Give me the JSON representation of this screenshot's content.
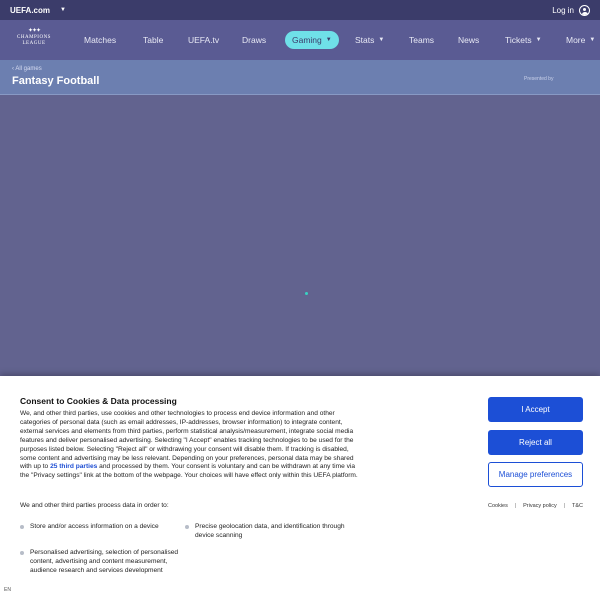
{
  "topbar": {
    "brand": "UEFA.com",
    "login": "Log in"
  },
  "logo": {
    "line1": "CHAMPIONS",
    "line2": "LEAGUE"
  },
  "nav": {
    "matches": "Matches",
    "table": "Table",
    "uefatv": "UEFA.tv",
    "draws": "Draws",
    "gaming": "Gaming",
    "stats": "Stats",
    "teams": "Teams",
    "news": "News",
    "tickets": "Tickets",
    "more": "More"
  },
  "header": {
    "back": "All games",
    "title": "Fantasy Football",
    "presented": "Presented by"
  },
  "consent": {
    "title": "Consent to Cookies & Data processing",
    "body_part1": "We, and other third parties, use cookies and other technologies to process end device information and other categories of personal data (such as email addresses, IP-addresses, browser information) to integrate content, external services and elements from third parties, perform statistical analysis/measurement, integrate social media features and deliver personalised advertising. Selecting \"I Accept\" enables tracking technologies to be used for the purposes listed below. Selecting \"Reject all\" or withdrawing your consent will disable them. If tracking is disabled, some content and advertising may be less relevant. Depending on your preferences, personal data may be shared with up to ",
    "body_link": "25 third parties",
    "body_part2": " and processed by them. Your consent is voluntary and can be withdrawn at any time via the \"Privacy settings\" link at the bottom of the webpage. Your choices will have effect only within this UEFA platform.",
    "purposes_heading": "We and other third parties process data in order to:",
    "purposes": [
      "Store and/or access information on a device",
      "Precise geolocation data, and identification through device scanning",
      "Personalised advertising, selection of personalised content, advertising and content measurement, audience research and services development"
    ],
    "accept": "I Accept",
    "reject": "Reject all",
    "manage": "Manage preferences",
    "links": {
      "cookies": "Cookies",
      "privacy": "Privacy policy",
      "tc": "T&C"
    },
    "lang": "EN"
  }
}
